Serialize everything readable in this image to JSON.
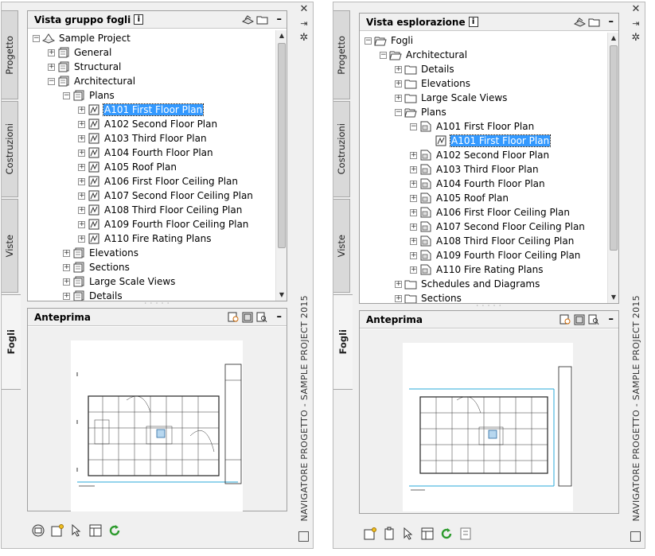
{
  "left": {
    "tabs": [
      "Progetto",
      "Costruzioni",
      "Viste",
      "Fogli"
    ],
    "active_tab": "Fogli",
    "tree_panel": {
      "title": "Vista gruppo fogli",
      "info": "i",
      "items": [
        {
          "label": "Sample Project",
          "level": 0,
          "exp": "−",
          "icon": "project-icon"
        },
        {
          "label": "General",
          "level": 1,
          "exp": "+",
          "icon": "sheet-group-icon"
        },
        {
          "label": "Structural",
          "level": 1,
          "exp": "+",
          "icon": "sheet-group-icon"
        },
        {
          "label": "Architectural",
          "level": 1,
          "exp": "−",
          "icon": "sheet-group-icon"
        },
        {
          "label": "Plans",
          "level": 2,
          "exp": "−",
          "icon": "sheet-group-icon"
        },
        {
          "label": "A101 First Floor Plan",
          "level": 3,
          "exp": "+",
          "icon": "sheet-icon",
          "selected": true
        },
        {
          "label": "A102 Second Floor Plan",
          "level": 3,
          "exp": "+",
          "icon": "sheet-icon"
        },
        {
          "label": "A103 Third Floor Plan",
          "level": 3,
          "exp": "+",
          "icon": "sheet-icon"
        },
        {
          "label": "A104 Fourth Floor Plan",
          "level": 3,
          "exp": "+",
          "icon": "sheet-icon"
        },
        {
          "label": "A105 Roof Plan",
          "level": 3,
          "exp": "+",
          "icon": "sheet-icon"
        },
        {
          "label": "A106 First Floor Ceiling Plan",
          "level": 3,
          "exp": "+",
          "icon": "sheet-icon"
        },
        {
          "label": "A107 Second Floor Ceiling Plan",
          "level": 3,
          "exp": "+",
          "icon": "sheet-icon"
        },
        {
          "label": "A108 Third Floor Ceiling Plan",
          "level": 3,
          "exp": "+",
          "icon": "sheet-icon"
        },
        {
          "label": "A109 Fourth Floor Ceiling Plan",
          "level": 3,
          "exp": "+",
          "icon": "sheet-icon"
        },
        {
          "label": "A110 Fire Rating Plans",
          "level": 3,
          "exp": "+",
          "icon": "sheet-icon"
        },
        {
          "label": "Elevations",
          "level": 2,
          "exp": "+",
          "icon": "sheet-group-icon"
        },
        {
          "label": "Sections",
          "level": 2,
          "exp": "+",
          "icon": "sheet-group-icon"
        },
        {
          "label": "Large Scale Views",
          "level": 2,
          "exp": "+",
          "icon": "sheet-group-icon"
        },
        {
          "label": "Details",
          "level": 2,
          "exp": "+",
          "icon": "sheet-group-icon"
        }
      ]
    },
    "preview_panel": {
      "title": "Anteprima"
    },
    "strip_title": "NAVIGATORE PROGETTO - SAMPLE PROJECT 2015",
    "bottom_buttons": [
      "publish-icon",
      "new-sheet-icon",
      "select-icon",
      "properties-icon",
      "refresh-icon"
    ]
  },
  "right": {
    "tabs": [
      "Progetto",
      "Costruzioni",
      "Viste",
      "Fogli"
    ],
    "active_tab": "Fogli",
    "tree_panel": {
      "title": "Vista esplorazione",
      "info": "i",
      "items": [
        {
          "label": "Fogli",
          "level": 0,
          "exp": "−",
          "icon": "folder-open-icon"
        },
        {
          "label": "Architectural",
          "level": 1,
          "exp": "−",
          "icon": "folder-open-icon"
        },
        {
          "label": "Details",
          "level": 2,
          "exp": "+",
          "icon": "folder-icon"
        },
        {
          "label": "Elevations",
          "level": 2,
          "exp": "+",
          "icon": "folder-icon"
        },
        {
          "label": "Large Scale Views",
          "level": 2,
          "exp": "+",
          "icon": "folder-icon"
        },
        {
          "label": "Plans",
          "level": 2,
          "exp": "−",
          "icon": "folder-open-icon"
        },
        {
          "label": "A101 First Floor Plan",
          "level": 3,
          "exp": "−",
          "icon": "sheet-file-icon"
        },
        {
          "label": "A101 First Floor Plan",
          "level": 4,
          "exp": "",
          "icon": "sheet-icon",
          "selected": true
        },
        {
          "label": "A102 Second Floor Plan",
          "level": 3,
          "exp": "+",
          "icon": "sheet-file-icon"
        },
        {
          "label": "A103 Third Floor Plan",
          "level": 3,
          "exp": "+",
          "icon": "sheet-file-icon"
        },
        {
          "label": "A104 Fourth Floor Plan",
          "level": 3,
          "exp": "+",
          "icon": "sheet-file-icon"
        },
        {
          "label": "A105 Roof Plan",
          "level": 3,
          "exp": "+",
          "icon": "sheet-file-icon"
        },
        {
          "label": "A106 First Floor Ceiling Plan",
          "level": 3,
          "exp": "+",
          "icon": "sheet-file-icon"
        },
        {
          "label": "A107 Second Floor Ceiling Plan",
          "level": 3,
          "exp": "+",
          "icon": "sheet-file-icon"
        },
        {
          "label": "A108 Third Floor Ceiling Plan",
          "level": 3,
          "exp": "+",
          "icon": "sheet-file-icon"
        },
        {
          "label": "A109 Fourth Floor Ceiling Plan",
          "level": 3,
          "exp": "+",
          "icon": "sheet-file-icon"
        },
        {
          "label": "A110 Fire Rating Plans",
          "level": 3,
          "exp": "+",
          "icon": "sheet-file-icon"
        },
        {
          "label": "Schedules and Diagrams",
          "level": 2,
          "exp": "+",
          "icon": "folder-icon"
        },
        {
          "label": "Sections",
          "level": 2,
          "exp": "+",
          "icon": "folder-icon"
        }
      ]
    },
    "preview_panel": {
      "title": "Anteprima"
    },
    "strip_title": "NAVIGATORE PROGETTO - SAMPLE PROJECT 2015",
    "bottom_buttons": [
      "new-sheet-icon",
      "clipboard-icon",
      "select-icon",
      "properties-icon",
      "refresh-icon",
      "layout-icon"
    ]
  },
  "colors": {
    "selection": "#3399ff",
    "accent_green": "#2e9b2e"
  }
}
